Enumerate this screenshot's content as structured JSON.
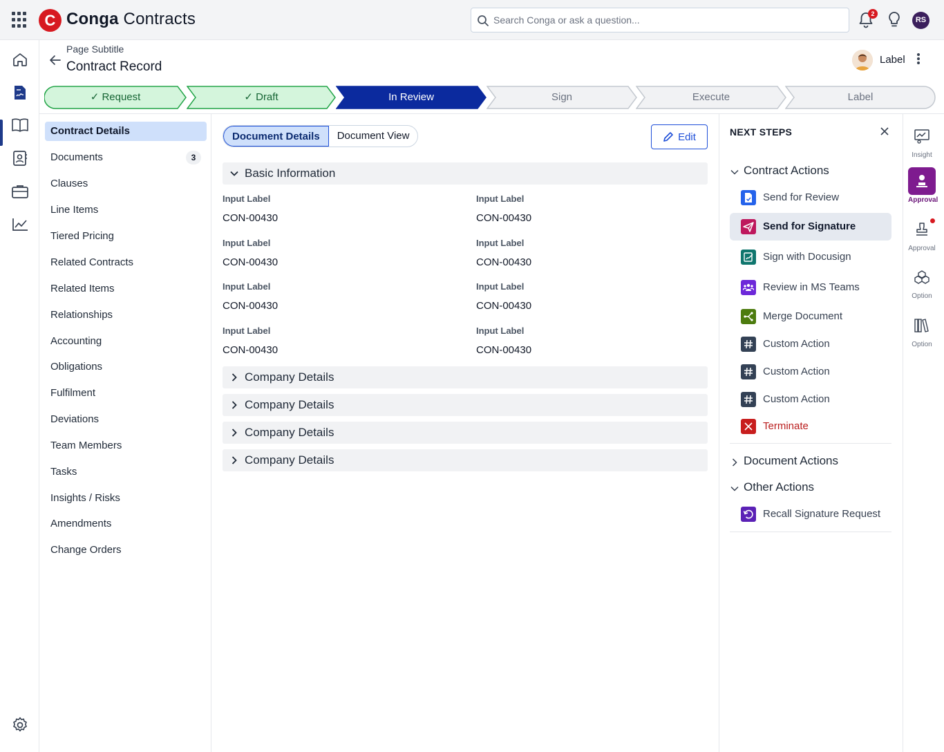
{
  "app": {
    "brand": "Conga",
    "product": "Contracts",
    "logo_letter": "C"
  },
  "search": {
    "placeholder": "Search Conga or ask a question..."
  },
  "notifications": {
    "count": "2"
  },
  "user": {
    "initials": "RS"
  },
  "header": {
    "subtitle": "Page Subtitle",
    "title": "Contract Record",
    "user_label": "Label"
  },
  "path": {
    "steps": [
      {
        "label": "Request",
        "state": "done"
      },
      {
        "label": "Draft",
        "state": "done"
      },
      {
        "label": "In Review",
        "state": "current"
      },
      {
        "label": "Sign",
        "state": "todo"
      },
      {
        "label": "Execute",
        "state": "todo"
      },
      {
        "label": "Label",
        "state": "todo"
      }
    ]
  },
  "sidebar": {
    "items": [
      {
        "label": "Contract Details",
        "active": true
      },
      {
        "label": "Documents",
        "count": "3"
      },
      {
        "label": "Clauses"
      },
      {
        "label": "Line Items"
      },
      {
        "label": "Tiered Pricing"
      },
      {
        "label": "Related Contracts"
      },
      {
        "label": "Related Items"
      },
      {
        "label": "Relationships"
      },
      {
        "label": "Accounting"
      },
      {
        "label": "Obligations"
      },
      {
        "label": "Fulfilment"
      },
      {
        "label": "Deviations"
      },
      {
        "label": "Team Members"
      },
      {
        "label": "Tasks"
      },
      {
        "label": "Insights / Risks"
      },
      {
        "label": "Amendments"
      },
      {
        "label": "Change Orders"
      }
    ]
  },
  "main": {
    "tabs": [
      {
        "label": "Document Details"
      },
      {
        "label": "Document View"
      }
    ],
    "edit_label": "Edit",
    "basic_section": "Basic Information",
    "fields": [
      {
        "label": "Input Label",
        "value": "CON-00430"
      },
      {
        "label": "Input Label",
        "value": "CON-00430"
      },
      {
        "label": "Input Label",
        "value": "CON-00430"
      },
      {
        "label": "Input Label",
        "value": "CON-00430"
      },
      {
        "label": "Input Label",
        "value": "CON-00430"
      },
      {
        "label": "Input Label",
        "value": "CON-00430"
      },
      {
        "label": "Input Label",
        "value": "CON-00430"
      },
      {
        "label": "Input Label",
        "value": "CON-00430"
      }
    ],
    "collapsed_sections": [
      "Company Details",
      "Company Details",
      "Company Details",
      "Company Details"
    ]
  },
  "next_steps": {
    "title": "NEXT STEPS",
    "contract_actions": {
      "label": "Contract Actions",
      "items": [
        {
          "label": "Send for Review",
          "icon": "document-check-icon",
          "color": "#2563eb"
        },
        {
          "label": "Send for Signature",
          "icon": "paper-plane-icon",
          "color": "#be185d",
          "selected": true
        },
        {
          "label": "Sign with Docusign",
          "icon": "docusign-icon",
          "color": "#0f766e"
        },
        {
          "label": "Review in MS Teams",
          "icon": "teams-icon",
          "color": "#6d28d9"
        },
        {
          "label": "Merge Document",
          "icon": "merge-icon",
          "color": "#4d7c0f"
        },
        {
          "label": "Custom Action",
          "icon": "hash-icon",
          "color": "#334155"
        },
        {
          "label": "Custom Action",
          "icon": "hash-icon",
          "color": "#334155"
        },
        {
          "label": "Custom Action",
          "icon": "hash-icon",
          "color": "#334155"
        },
        {
          "label": "Terminate",
          "icon": "close-icon",
          "color": "#c81e1e"
        }
      ]
    },
    "document_actions": {
      "label": "Document Actions"
    },
    "other_actions": {
      "label": "Other Actions",
      "items": [
        {
          "label": "Recall Signature Request",
          "icon": "undo-icon",
          "color": "#5b21b6"
        }
      ]
    }
  },
  "utility_rail": [
    {
      "label": "Insight",
      "icon": "insight-icon"
    },
    {
      "label": "Approval",
      "icon": "approval-icon",
      "active": true
    },
    {
      "label": "Approval",
      "icon": "stamp-icon",
      "has_alert": true
    },
    {
      "label": "Option",
      "icon": "boxes-icon"
    },
    {
      "label": "Option",
      "icon": "books-icon"
    }
  ]
}
